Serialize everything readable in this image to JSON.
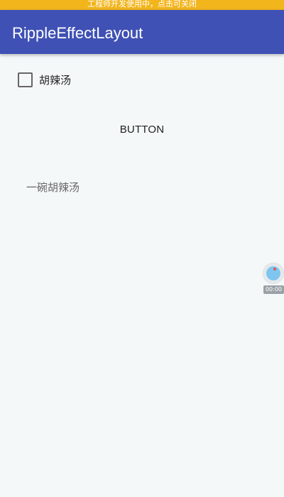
{
  "status_bar": {
    "notice": "工程师开发使用中，点击可关闭"
  },
  "app_bar": {
    "title": "RippleEffectLayout"
  },
  "checkbox": {
    "label": "胡辣汤",
    "checked": false
  },
  "button": {
    "label": "BUTTON"
  },
  "content": {
    "text": "一碗胡辣汤"
  },
  "floating_widget": {
    "icon": "record-icon",
    "time": "00:00"
  },
  "colors": {
    "status_bar": "#f3b51c",
    "app_bar": "#3f51b5",
    "background": "#f4f8f9",
    "record_dot": "#e2554f",
    "record_inner": "#7ec6ef"
  }
}
